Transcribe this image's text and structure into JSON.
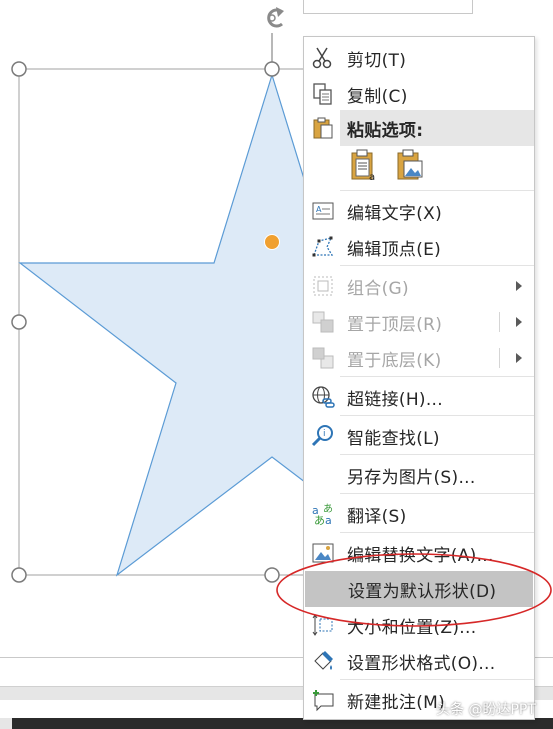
{
  "menu": {
    "items": [
      {
        "label": "剪切(T)",
        "icon": "scissors-icon",
        "disabled": false
      },
      {
        "label": "复制(C)",
        "icon": "copy-icon",
        "disabled": false
      },
      {
        "label": "粘贴选项:",
        "icon": "clipboard-icon",
        "disabled": false
      },
      {
        "label": "编辑文字(X)",
        "icon": "edit-text-icon",
        "disabled": false
      },
      {
        "label": "编辑顶点(E)",
        "icon": "edit-points-icon",
        "disabled": false
      },
      {
        "label": "组合(G)",
        "icon": "group-icon",
        "disabled": true
      },
      {
        "label": "置于顶层(R)",
        "icon": "bring-to-front-icon",
        "disabled": true
      },
      {
        "label": "置于底层(K)",
        "icon": "send-to-back-icon",
        "disabled": true
      },
      {
        "label": "超链接(H)...",
        "icon": "hyperlink-icon",
        "disabled": false
      },
      {
        "label": "智能查找(L)",
        "icon": "smart-lookup-icon",
        "disabled": false
      },
      {
        "label": "另存为图片(S)...",
        "icon": "",
        "disabled": false
      },
      {
        "label": "翻译(S)",
        "icon": "translate-icon",
        "disabled": false
      },
      {
        "label": "编辑替换文字(A)...",
        "icon": "alt-text-icon",
        "disabled": false
      },
      {
        "label": "设置为默认形状(D)",
        "icon": "",
        "disabled": false,
        "highlighted": true
      },
      {
        "label": "大小和位置(Z)...",
        "icon": "size-position-icon",
        "disabled": false
      },
      {
        "label": "设置形状格式(O)...",
        "icon": "format-shape-icon",
        "disabled": false
      },
      {
        "label": "新建批注(M)",
        "icon": "new-comment-icon",
        "disabled": false
      }
    ],
    "paste_options": [
      "paste-keep-text-icon",
      "paste-picture-icon"
    ]
  },
  "colors": {
    "star_fill": "#ddeaf7",
    "star_stroke": "#5b9bd5",
    "handle_adjust": "#f0a030",
    "annotation": "#d62828",
    "highlight": "#c4c4c4"
  },
  "watermark": "头条 @盼达PPT"
}
